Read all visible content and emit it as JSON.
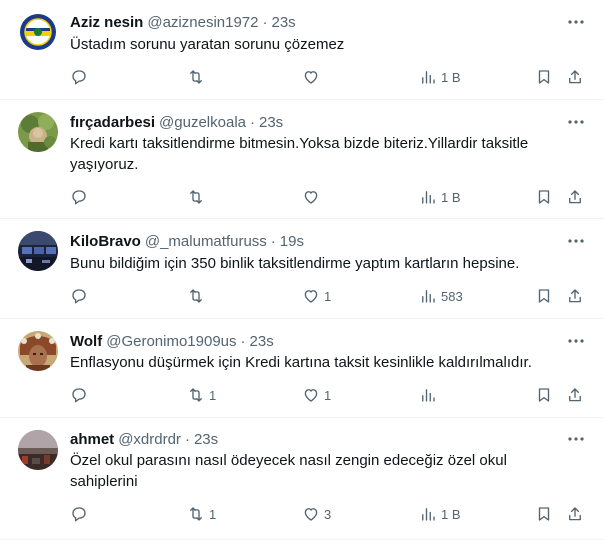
{
  "tweets": [
    {
      "name": "Aziz nesin",
      "handle": "@aziznesin1972",
      "time": "23s",
      "text": "Üstadım sorunu yaratan sorunu  çözemez",
      "replies": "",
      "retweets": "",
      "likes": "",
      "views": "1 B",
      "avatar": "fenerbahce-logo"
    },
    {
      "name": "fırçadarbesi",
      "handle": "@guzelkoala",
      "time": "23s",
      "text": "Kredi kartı taksitlendirme bitmesin.Yoksa bizde biteriz.Yillardir taksitle yaşıyoruz.",
      "replies": "",
      "retweets": "",
      "likes": "",
      "views": "1 B",
      "avatar": "painting"
    },
    {
      "name": "KiloBravo",
      "handle": "@_malumatfuruss",
      "time": "19s",
      "text": "Bunu bildiğim için 350 binlik taksitlendirme yaptım kartların hepsine.",
      "replies": "",
      "retweets": "",
      "likes": "1",
      "views": "583",
      "avatar": "cockpit"
    },
    {
      "name": "Wolf",
      "handle": "@Geronimo1909us",
      "time": "23s",
      "text": "Enflasyonu düşürmek için Kredi kartına taksit kesinlikle kaldırılmalıdır.",
      "replies": "",
      "retweets": "1",
      "likes": "1",
      "views": "",
      "avatar": "portrait"
    },
    {
      "name": "ahmet",
      "handle": "@xdrdrdr",
      "time": "23s",
      "text": "Özel okul parasını nasıl ödeyecek nasıl zengin edeceğiz özel okul sahiplerini",
      "replies": "",
      "retweets": "1",
      "likes": "3",
      "views": "1 B",
      "avatar": "city-skyline"
    }
  ],
  "separator": "·",
  "colors": {
    "text": "#0f1419",
    "secondary": "#536471",
    "border": "#eff3f4",
    "background": "#ffffff"
  },
  "icons": [
    "more-icon",
    "reply-icon",
    "retweet-icon",
    "like-icon",
    "views-icon",
    "bookmark-icon",
    "share-icon"
  ]
}
